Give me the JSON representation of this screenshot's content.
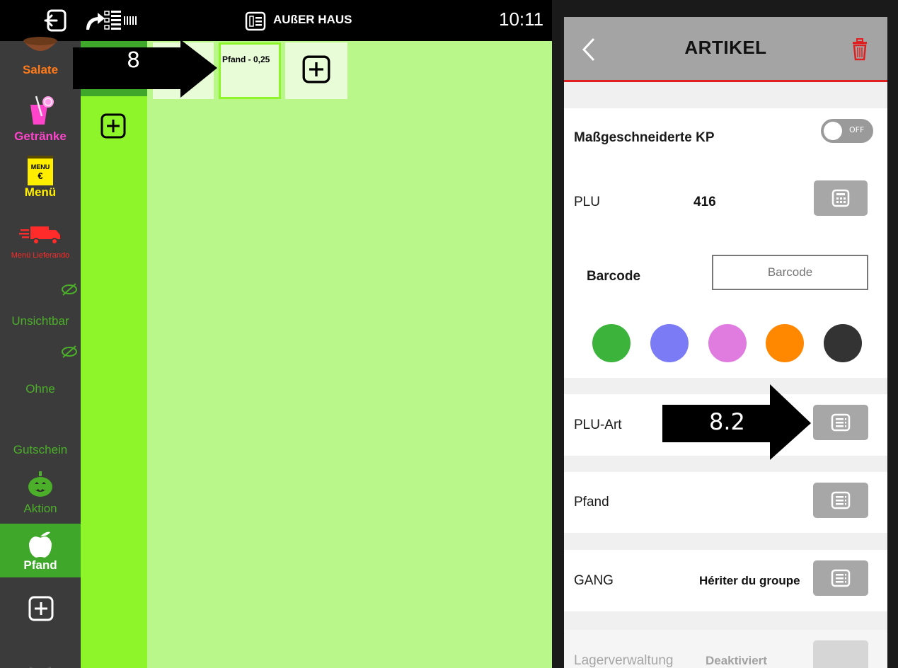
{
  "statusbar": {
    "mode_label": "AUßER HAUS",
    "time": "10:11"
  },
  "categories": [
    {
      "label": "Salate",
      "color": "#ff7a1a",
      "icon": "salad-bowl-icon"
    },
    {
      "label": "Getränke",
      "color": "#ff44cc",
      "icon": "drink-icon"
    },
    {
      "label": "Menü",
      "color": "#ffee00",
      "icon": "menu-card-icon",
      "card_text": "MENU",
      "card_symbol": "€"
    },
    {
      "label": "Menü Lieferando",
      "color": "#ff2a2a",
      "icon": "delivery-truck-icon"
    },
    {
      "label": "Unsichtbar",
      "color": "#4caf2a",
      "icon": "eye-slash-icon"
    },
    {
      "label": "Ohne",
      "color": "#4caf2a",
      "icon": "eye-slash-icon"
    },
    {
      "label": "Gutschein",
      "color": "#4caf2a",
      "icon": ""
    },
    {
      "label": "Aktion",
      "color": "#4caf2a",
      "icon": "pumpkin-icon"
    },
    {
      "label": "Pfand",
      "color": "#ffffff",
      "icon": "apple-icon"
    }
  ],
  "workarea": {
    "item_tile_label": "Pfand - 0,25"
  },
  "annotations": {
    "arrow1": "8",
    "arrow2": "8.2"
  },
  "panel": {
    "title": "ARTIKEL",
    "custom_price_label": "Maßgeschneiderte KP",
    "custom_price_toggle": "OFF",
    "plu_label": "PLU",
    "plu_value": "416",
    "barcode_label": "Barcode",
    "barcode_placeholder": "Barcode",
    "colors": [
      "#3cb43c",
      "#7b7bf5",
      "#e07be0",
      "#ff8800",
      "#333333"
    ],
    "plu_type_label": "PLU-Art",
    "deposit_label": "Pfand",
    "course_label": "GANG",
    "course_value": "Hériter du groupe",
    "stock_label": "Lagerverwaltung",
    "stock_value": "Deaktiviert"
  },
  "accent": {
    "brand_red": "#e02020",
    "group_green": "#8ef52a",
    "area_green": "#baf78a"
  }
}
